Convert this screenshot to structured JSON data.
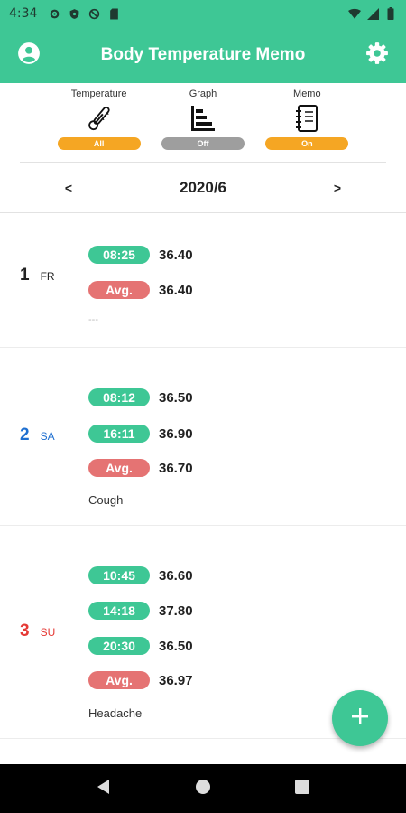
{
  "status_bar": {
    "time": "4:34"
  },
  "app_bar": {
    "title": "Body Temperature Memo"
  },
  "modes": [
    {
      "label": "Temperature",
      "state": "All",
      "color": "#f5a623"
    },
    {
      "label": "Graph",
      "state": "Off",
      "color": "#9e9e9e"
    },
    {
      "label": "Memo",
      "state": "On",
      "color": "#f5a623"
    }
  ],
  "month": {
    "label": "2020/6",
    "prev": "<",
    "next": ">"
  },
  "colors": {
    "accent": "#3ec795",
    "avg": "#e57373",
    "saturday": "#1e6fd0",
    "sunday": "#e53935",
    "weekday": "#222222"
  },
  "days": [
    {
      "num": "1",
      "weekday": "FR",
      "readings": [
        {
          "time": "08:25",
          "temp": "36.40"
        },
        {
          "time": "Avg.",
          "temp": "36.40"
        }
      ],
      "memo": "---"
    },
    {
      "num": "2",
      "weekday": "SA",
      "readings": [
        {
          "time": "08:12",
          "temp": "36.50"
        },
        {
          "time": "16:11",
          "temp": "36.90"
        },
        {
          "time": "Avg.",
          "temp": "36.70"
        }
      ],
      "memo": "Cough"
    },
    {
      "num": "3",
      "weekday": "SU",
      "readings": [
        {
          "time": "10:45",
          "temp": "36.60"
        },
        {
          "time": "14:18",
          "temp": "37.80"
        },
        {
          "time": "20:30",
          "temp": "36.50"
        },
        {
          "time": "Avg.",
          "temp": "36.97"
        }
      ],
      "memo": "Headache"
    }
  ]
}
